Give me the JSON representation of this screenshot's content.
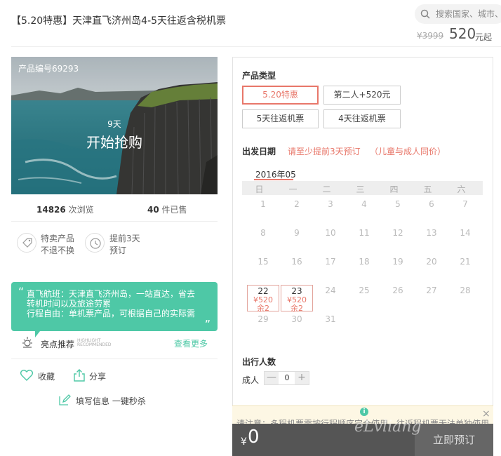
{
  "header": {
    "title": "【5.20特惠】天津直飞济州岛4-5天往返含税机票",
    "search_placeholder": "搜索国家、城市、",
    "old_price": "¥3999",
    "price": "520",
    "price_suffix": "元起"
  },
  "hero": {
    "product_no": "产品编号69293",
    "days": "9天",
    "cta": "开始抢购"
  },
  "stats": {
    "views_num": "14826",
    "views_label": "次浏览",
    "sold_num": "40",
    "sold_label": "件已售"
  },
  "features": [
    {
      "label": "特卖产品不退不换",
      "icon": "tag-icon"
    },
    {
      "label": "提前3天预订",
      "icon": "clock-icon"
    }
  ],
  "quote": {
    "line1": "直飞航班：天津直飞济州岛，一站直达，省去",
    "line2": "转机时间以及旅途劳累",
    "line3": "行程自由：单机票产品，可根据自己的实际需",
    "open": "“",
    "close": "„"
  },
  "highlight": {
    "label": "亮点推荐",
    "sub": "HIGHLIGHT RECOMMENDED",
    "more": "查看更多",
    "icon": "sun-icon"
  },
  "actions": {
    "favorite": "收藏",
    "share": "分享",
    "fill": "填写信息 一键秒杀"
  },
  "panel": {
    "product_type_title": "产品类型",
    "options": [
      "5.20特惠",
      "第二人+520元",
      "5天往返机票",
      "4天往返机票"
    ],
    "selected_option": "5.20特惠",
    "date_title": "出发日期",
    "date_note1": "请至少提前3天预订",
    "date_note2": "（儿童与成人同价）",
    "month": "2016年05",
    "weekdays": [
      "日",
      "一",
      "二",
      "三",
      "四",
      "五",
      "六"
    ],
    "weeks": [
      [
        "1",
        "2",
        "3",
        "4",
        "5",
        "6",
        "7"
      ],
      [
        "8",
        "9",
        "10",
        "11",
        "12",
        "13",
        "14"
      ],
      [
        "15",
        "16",
        "17",
        "18",
        "19",
        "20",
        "21"
      ],
      [
        "22",
        "23",
        "24",
        "25",
        "26",
        "27",
        "28"
      ],
      [
        "29",
        "30",
        "31"
      ]
    ],
    "available": [
      {
        "day": "22",
        "price": "¥520",
        "remain": "余2"
      },
      {
        "day": "23",
        "price": "¥520",
        "remain": "余2"
      }
    ],
    "pax_title": "出行人数",
    "pax_label": "成人",
    "pax_minus": "—",
    "pax_qty": "0",
    "pax_plus": "+",
    "notice": "请注意：多程机票需按行程顺序完全使用，往返程机票无法单独使用",
    "info_icon": "i",
    "close_icon": "×",
    "currency": "¥",
    "total": "0",
    "book": "立即预订"
  },
  "watermark": "eLvliang",
  "colors": {
    "accent": "#e8776a",
    "green": "#4ec8a6",
    "bar": "#555555"
  }
}
